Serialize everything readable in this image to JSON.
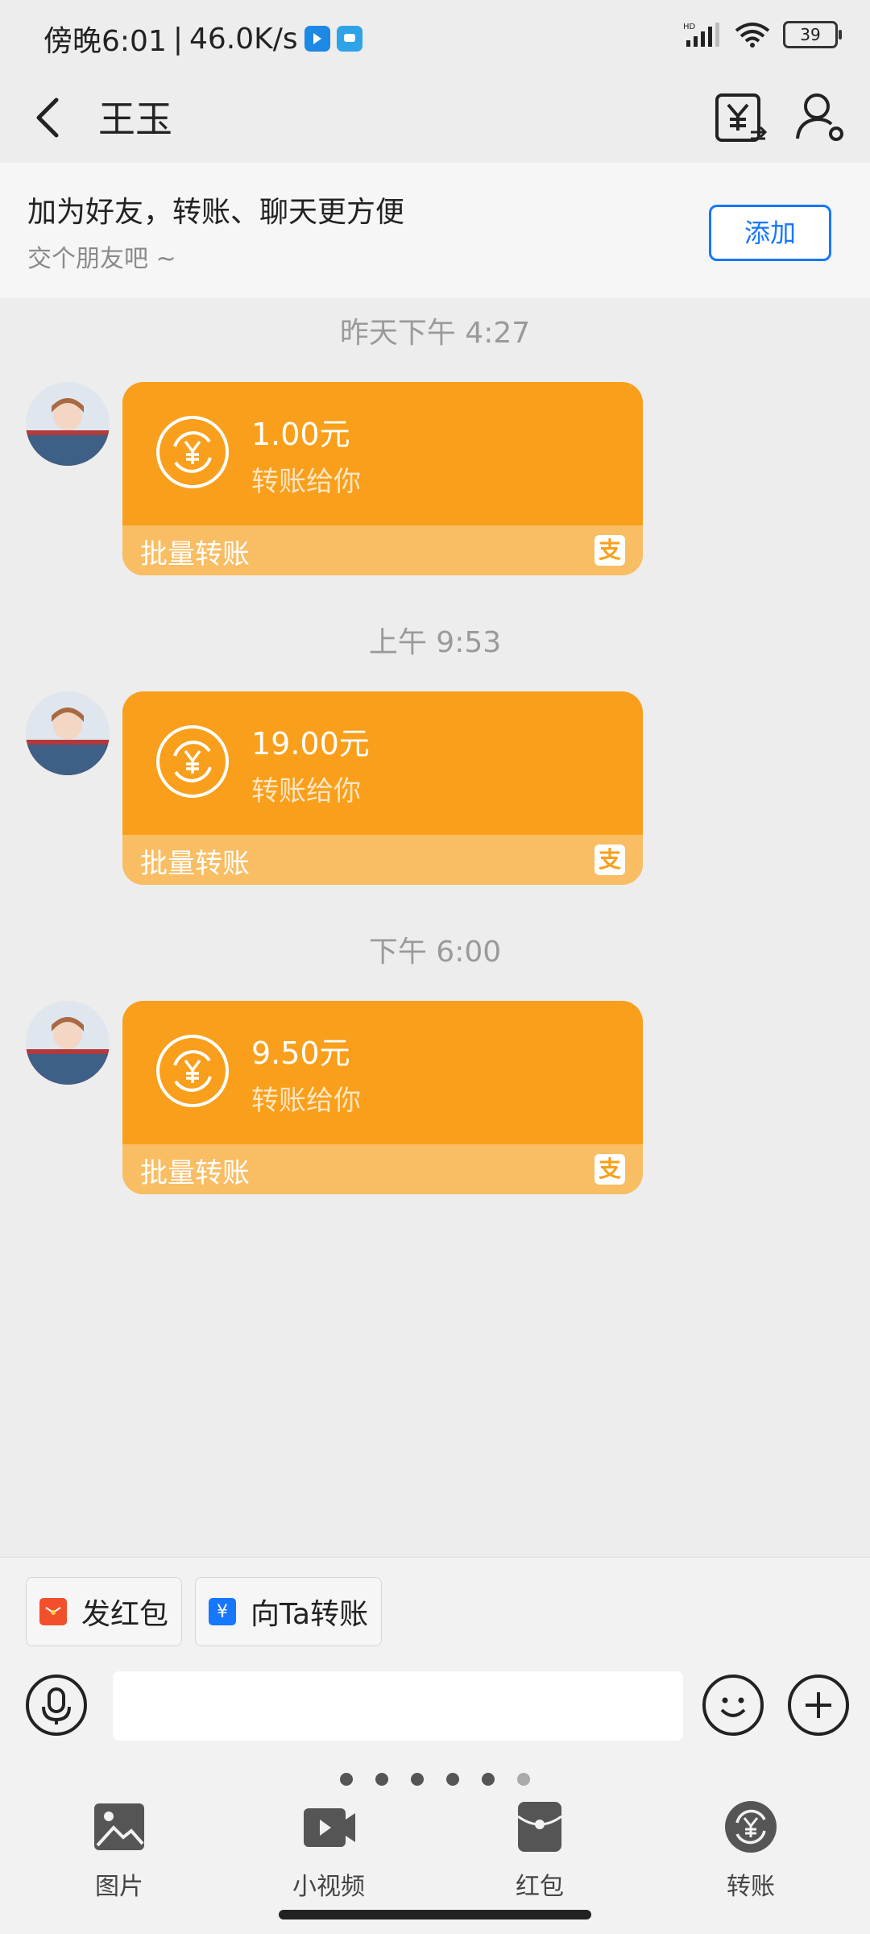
{
  "status_bar": {
    "time": "傍晚6:01",
    "speed": "46.0K/s",
    "battery": "39",
    "signal_label": "HD"
  },
  "header": {
    "title": "王玉"
  },
  "banner": {
    "title": "加为好友，转账、聊天更方便",
    "subtitle": "交个朋友吧 ~",
    "add_label": "添加"
  },
  "messages": [
    {
      "time": "昨天下午 4:27",
      "amount": "1.00元",
      "desc": "转账给你",
      "footer": "批量转账"
    },
    {
      "time": "上午 9:53",
      "amount": "19.00元",
      "desc": "转账给你",
      "footer": "批量转账"
    },
    {
      "time": "下午 6:00",
      "amount": "9.50元",
      "desc": "转账给你",
      "footer": "批量转账"
    }
  ],
  "quick_actions": [
    {
      "label": "发红包",
      "icon": "red-packet-icon",
      "color": "#f2502a"
    },
    {
      "label": "向Ta转账",
      "icon": "transfer-icon",
      "color": "#1677ff"
    }
  ],
  "input": {
    "placeholder": ""
  },
  "panel": {
    "items": [
      {
        "label": "图片"
      },
      {
        "label": "小视频"
      },
      {
        "label": "红包"
      },
      {
        "label": "转账"
      }
    ]
  },
  "colors": {
    "card": "#f99f1b",
    "card_footer": "#f9bd63",
    "accent": "#1677ff"
  }
}
